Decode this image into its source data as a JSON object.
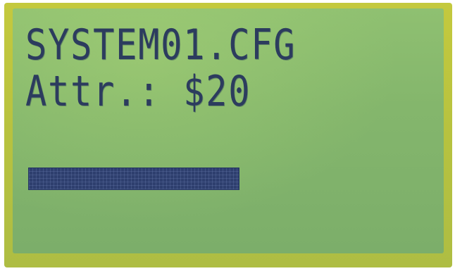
{
  "display": {
    "line1": "SYSTEM01.CFG",
    "line2": "Attr.: $20"
  },
  "progress": {
    "fraction": 0.49
  },
  "colors": {
    "pixel": "#2c3c5e",
    "lcd_background": "#84b66c",
    "bezel": "#b7c23f"
  }
}
